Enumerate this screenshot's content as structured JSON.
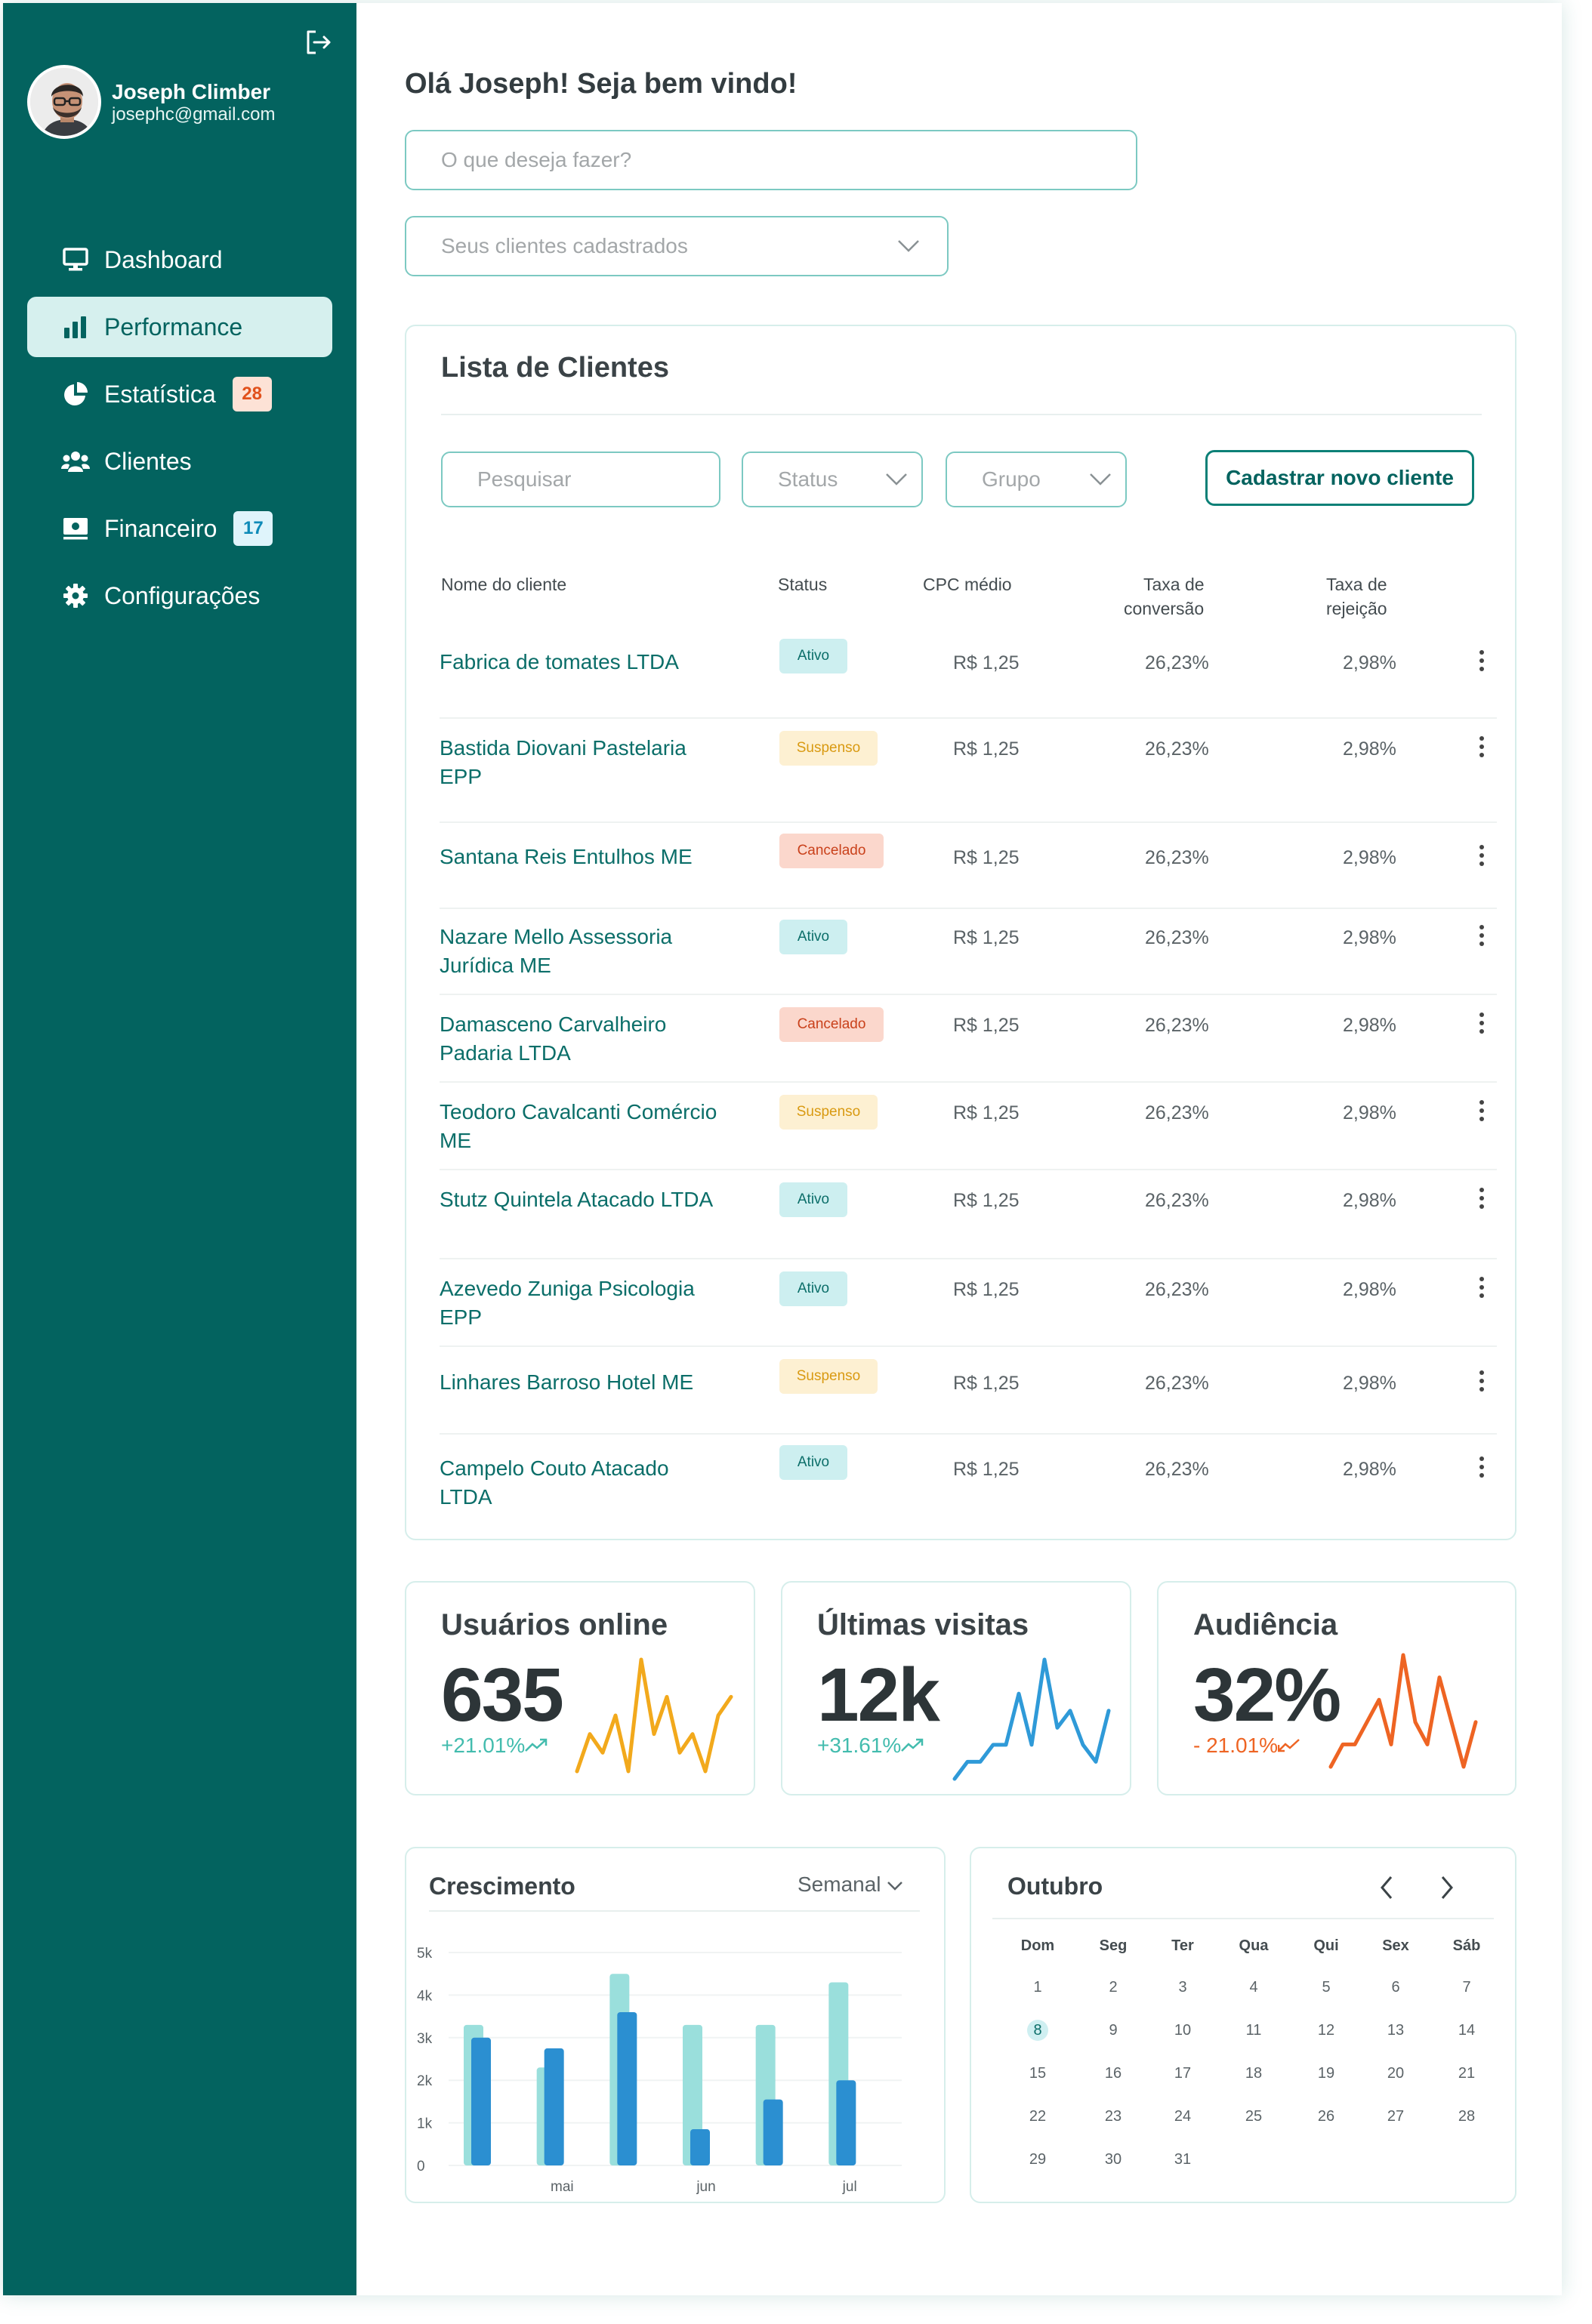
{
  "user": {
    "name": "Joseph Climber",
    "email": "josephc@gmail.com"
  },
  "nav": [
    {
      "label": "Dashboard",
      "icon": "monitor-icon",
      "active": false
    },
    {
      "label": "Performance",
      "icon": "bar-chart-icon",
      "active": true
    },
    {
      "label": "Estatística",
      "icon": "pie-chart-icon",
      "badge": "28",
      "badge_color": "#fde2d6"
    },
    {
      "label": "Clientes",
      "icon": "users-icon"
    },
    {
      "label": "Financeiro",
      "icon": "money-icon",
      "badge": "17",
      "badge_color": "#dff4fb"
    },
    {
      "label": "Configurações",
      "icon": "gear-icon"
    }
  ],
  "header": {
    "greeting": "Olá Joseph! Seja bem vindo!"
  },
  "search": {
    "placeholder": "O que deseja fazer?"
  },
  "client_select": {
    "placeholder": "Seus clientes cadastrados"
  },
  "clients_card": {
    "title": "Lista de Clientes",
    "search_placeholder": "Pesquisar",
    "status_filter": "Status",
    "group_filter": "Grupo",
    "new_client_button": "Cadastrar novo cliente",
    "columns": {
      "name": "Nome do cliente",
      "status": "Status",
      "cpc": "CPC médio",
      "conv_1": "Taxa de",
      "conv_2": "conversão",
      "rej_1": "Taxa de",
      "rej_2": "rejeição"
    },
    "rows": [
      {
        "name": "Fabrica de tomates LTDA",
        "status": "Ativo",
        "cpc": "R$ 1,25",
        "conv": "26,23%",
        "rej": "2,98%"
      },
      {
        "name": "Bastida Diovani Pastelaria EPP",
        "status": "Suspenso",
        "cpc": "R$ 1,25",
        "conv": "26,23%",
        "rej": "2,98%"
      },
      {
        "name": "Santana Reis Entulhos ME",
        "status": "Cancelado",
        "cpc": "R$ 1,25",
        "conv": "26,23%",
        "rej": "2,98%"
      },
      {
        "name": "Nazare Mello Assessoria Jurídica ME",
        "status": "Ativo",
        "cpc": "R$ 1,25",
        "conv": "26,23%",
        "rej": "2,98%"
      },
      {
        "name": "Damasceno Carvalheiro Padaria LTDA",
        "status": "Cancelado",
        "cpc": "R$ 1,25",
        "conv": "26,23%",
        "rej": "2,98%"
      },
      {
        "name": "Teodoro Cavalcanti Comércio ME",
        "status": "Suspenso",
        "cpc": "R$ 1,25",
        "conv": "26,23%",
        "rej": "2,98%"
      },
      {
        "name": "Stutz Quintela Atacado LTDA",
        "status": "Ativo",
        "cpc": "R$ 1,25",
        "conv": "26,23%",
        "rej": "2,98%"
      },
      {
        "name": "Azevedo Zuniga Psicologia EPP",
        "status": "Ativo",
        "cpc": "R$ 1,25",
        "conv": "26,23%",
        "rej": "2,98%"
      },
      {
        "name": "Linhares Barroso Hotel ME",
        "status": "Suspenso",
        "cpc": "R$ 1,25",
        "conv": "26,23%",
        "rej": "2,98%"
      },
      {
        "name": "Campelo Couto Atacado LTDA",
        "status": "Ativo",
        "cpc": "R$ 1,25",
        "conv": "26,23%",
        "rej": "2,98%"
      }
    ]
  },
  "stats": [
    {
      "title": "Usuários online",
      "value": "635",
      "change": "+21.01%",
      "trend": "up",
      "color": "#f2a91c",
      "spark": [
        1,
        3,
        2,
        4,
        1,
        7,
        3,
        5,
        2,
        3,
        1,
        4,
        5
      ]
    },
    {
      "title": "Últimas visitas",
      "value": "12k",
      "change": "+31.61%",
      "trend": "up",
      "color": "#2f9ad8",
      "spark": [
        1,
        2,
        2,
        3,
        3,
        6,
        3,
        8,
        4,
        5,
        3,
        2,
        5
      ]
    },
    {
      "title": "Audiência",
      "value": "32%",
      "change": "- 21.01%",
      "trend": "down",
      "color": "#ee6423",
      "spark": [
        2,
        3,
        3,
        4,
        5,
        3,
        7,
        4,
        3,
        6,
        4,
        2,
        4
      ]
    }
  ],
  "growth": {
    "title": "Crescimento",
    "period": "Semanal"
  },
  "chart_data": {
    "type": "bar",
    "categories": [
      "",
      "mai",
      "",
      "jun",
      "",
      "jul"
    ],
    "series": [
      {
        "values": [
          3300,
          2300,
          4500,
          3300,
          3300,
          4300
        ],
        "color": "#9adfdc"
      },
      {
        "values": [
          3000,
          2750,
          3600,
          850,
          1550,
          2000
        ],
        "color": "#2b8fd1"
      }
    ],
    "ylim": [
      0,
      5000
    ],
    "yticks": [
      "0",
      "1k",
      "2k",
      "3k",
      "4k",
      "5k"
    ]
  },
  "calendar": {
    "month": "Outubro",
    "weekdays": [
      "Dom",
      "Seg",
      "Ter",
      "Qua",
      "Qui",
      "Sex",
      "Sáb"
    ],
    "days": [
      "1",
      "2",
      "3",
      "4",
      "5",
      "6",
      "7",
      "8",
      "9",
      "10",
      "11",
      "12",
      "13",
      "14",
      "15",
      "16",
      "17",
      "18",
      "19",
      "20",
      "21",
      "22",
      "23",
      "24",
      "25",
      "26",
      "27",
      "28",
      "29",
      "30",
      "31"
    ],
    "selected": "8"
  }
}
